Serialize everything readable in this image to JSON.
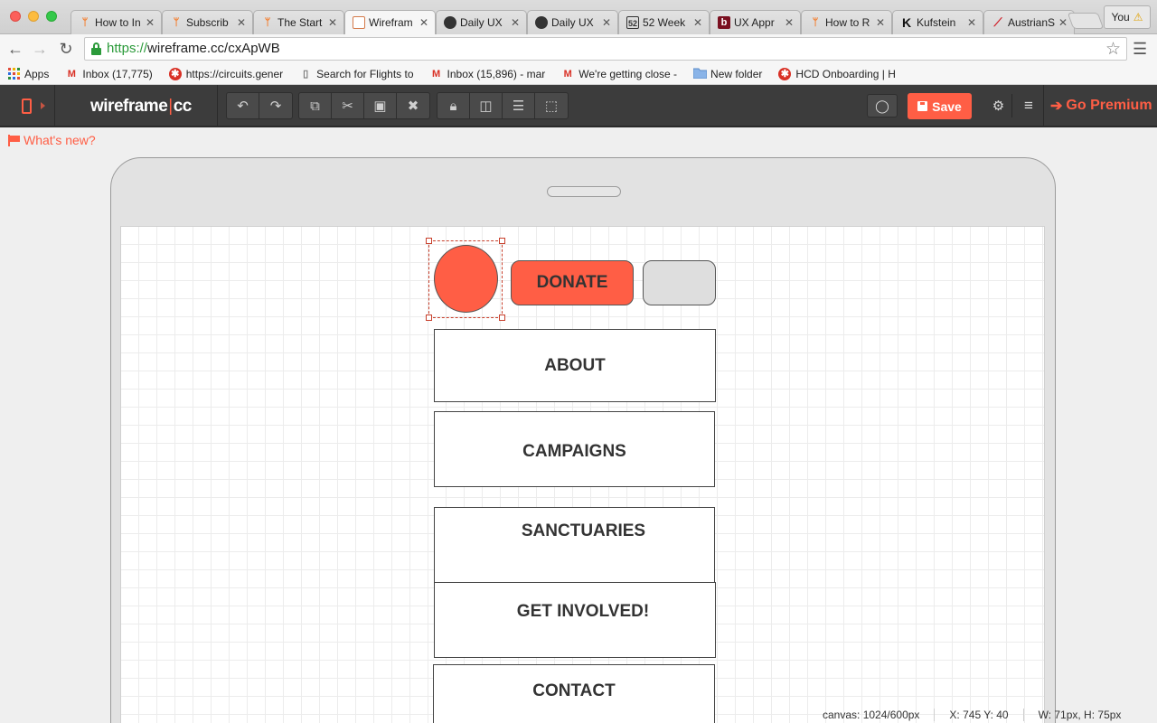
{
  "browser": {
    "tabs": [
      {
        "label": "How to In",
        "favicon": "hubspot-icon",
        "active": false
      },
      {
        "label": "Subscrib",
        "favicon": "hubspot-icon",
        "active": false
      },
      {
        "label": "The Start",
        "favicon": "hubspot-icon",
        "active": false
      },
      {
        "label": "Wirefram",
        "favicon": "wireframe-icon",
        "active": true
      },
      {
        "label": "Daily UX",
        "favicon": "dailyux-icon",
        "active": false
      },
      {
        "label": "Daily UX",
        "favicon": "dailyux-icon",
        "active": false
      },
      {
        "label": "52 Week",
        "favicon": "52weeks-icon",
        "active": false
      },
      {
        "label": "UX Appr",
        "favicon": "b-icon",
        "active": false
      },
      {
        "label": "How to R",
        "favicon": "hubspot-icon",
        "active": false
      },
      {
        "label": "Kufstein",
        "favicon": "k-icon",
        "active": false
      },
      {
        "label": "AustrianS",
        "favicon": "austrian-icon",
        "active": false
      }
    ],
    "profile_label": "You",
    "url_scheme": "https://",
    "url_rest": "wireframe.cc/cxApWB",
    "bookmarks": [
      {
        "label": "Apps",
        "icon": "apps-grid-icon"
      },
      {
        "label": "Inbox (17,775)",
        "icon": "gmail-icon"
      },
      {
        "label": "https://circuits.gener",
        "icon": "circuits-icon"
      },
      {
        "label": "Search for Flights to",
        "icon": "page-icon"
      },
      {
        "label": "Inbox (15,896) - mar",
        "icon": "gmail-icon"
      },
      {
        "label": "We're getting close -",
        "icon": "gmail-icon"
      },
      {
        "label": "New folder",
        "icon": "folder-icon"
      },
      {
        "label": "HCD Onboarding | H",
        "icon": "circuits-icon"
      }
    ]
  },
  "app": {
    "logo_left": "wireframe",
    "logo_sep": "|",
    "logo_right": "cc",
    "save_label": "Save",
    "premium_label": "Go Premium",
    "whats_new": "What's new?",
    "accent_color": "#ff5e45"
  },
  "canvas": {
    "donate_label": "DONATE",
    "menu": [
      {
        "label": "ABOUT"
      },
      {
        "label": "CAMPAIGNS"
      },
      {
        "label": "SANCTUARIES"
      },
      {
        "label": "GET INVOLVED!"
      },
      {
        "label": "CONTACT"
      }
    ]
  },
  "status": {
    "canvas_size": "canvas: 1024/600px",
    "position": "X: 745 Y: 40",
    "dimensions": "W: 71px, H: 75px"
  }
}
